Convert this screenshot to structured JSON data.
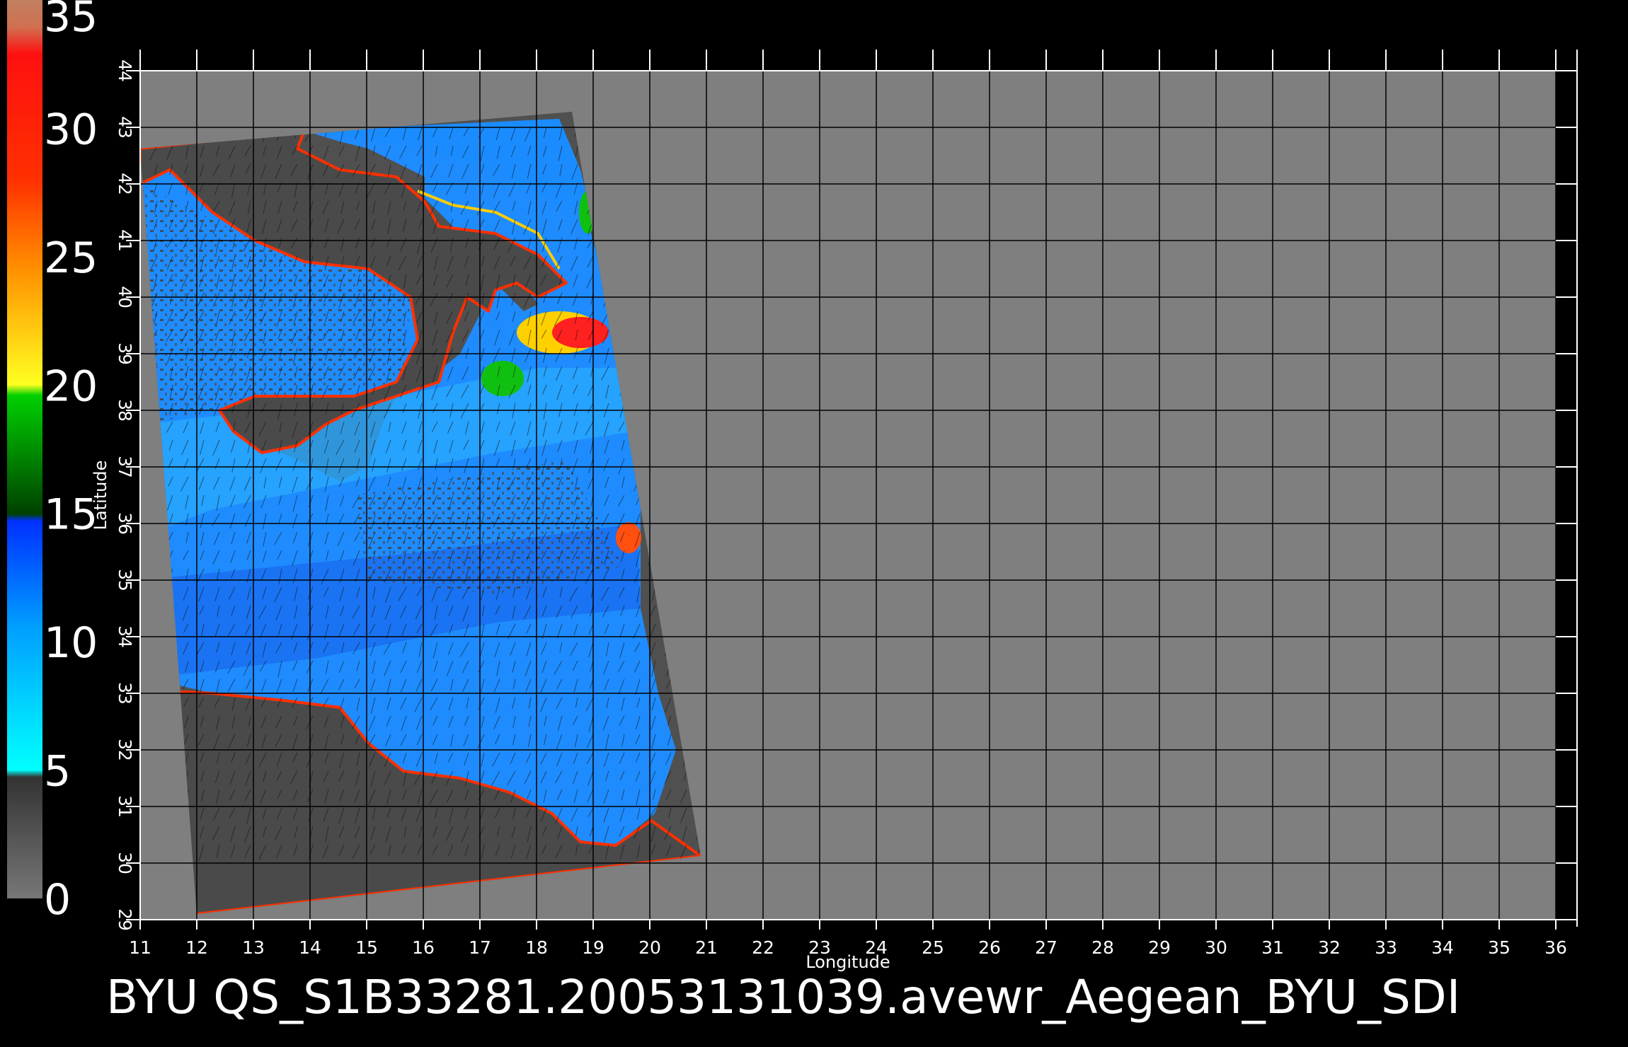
{
  "caption": "BYU QS_S1B33281.20053131039.avewr_Aegean_BYU_SDI",
  "axes": {
    "xlabel": "Longitude",
    "ylabel": "Latitude",
    "lon_range": [
      11,
      36
    ],
    "lat_range": [
      29,
      44
    ],
    "lon_ticks": [
      11,
      12,
      13,
      14,
      15,
      16,
      17,
      18,
      19,
      20,
      21,
      22,
      23,
      24,
      25,
      26,
      27,
      28,
      29,
      30,
      31,
      32,
      33,
      34,
      35,
      36
    ],
    "lat_ticks": [
      29,
      30,
      31,
      32,
      33,
      34,
      35,
      36,
      37,
      38,
      39,
      40,
      41,
      42,
      43,
      44
    ],
    "grid": true
  },
  "colorbar": {
    "labels": [
      "35",
      "30",
      "25",
      "20",
      "15",
      "10",
      "5",
      "0"
    ],
    "range": [
      0,
      35
    ],
    "colors": {
      "low": "#555555",
      "cyan": "#00ffff",
      "blue": "#0050ff",
      "green": "#00c000",
      "yellow": "#ffff00",
      "orange": "#ff8000",
      "red": "#ff2020",
      "top": "#c08060"
    }
  },
  "map_colors": {
    "background": "#7f7f7f",
    "swath": "#505050",
    "land": "#4a4a4a",
    "ocean": "#1e8cff",
    "coast": "#ff3000"
  }
}
